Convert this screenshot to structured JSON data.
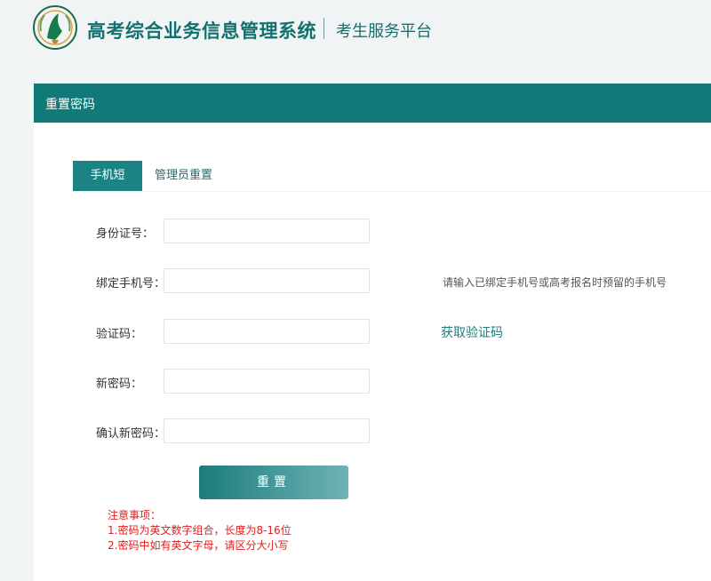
{
  "header": {
    "title": "高考综合业务信息管理系统",
    "subtitle": "考生服务平台",
    "logo_icon": "school-emblem-icon"
  },
  "card": {
    "title": "重置密码",
    "tabs": [
      {
        "label": "手机短信",
        "active": true
      },
      {
        "label": "管理员重置",
        "active": false
      }
    ]
  },
  "form": {
    "id_label": "身份证号：",
    "phone_label": "绑定手机号：",
    "phone_hint": "请输入已绑定手机号或高考报名时预留的手机号",
    "code_label": "验证码：",
    "get_code": "获取验证码",
    "new_pwd_label": "新密码：",
    "confirm_pwd_label": "确认新密码：",
    "id_value": "",
    "phone_value": "",
    "code_value": "",
    "new_pwd_value": "",
    "confirm_pwd_value": ""
  },
  "actions": {
    "reset_label": "重置"
  },
  "notes": {
    "title": "注意事项：",
    "items": [
      "1.密码为英文数字组合，长度为8-16位",
      "2.密码中如有英文字母，请区分大小写"
    ]
  },
  "colors": {
    "brand": "#0f7a78",
    "warning": "#e02020"
  }
}
